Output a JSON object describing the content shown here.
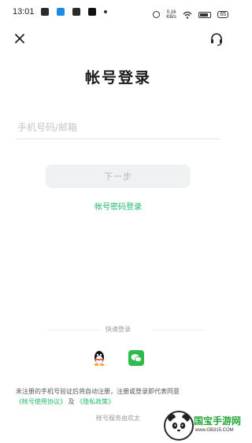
{
  "status_bar": {
    "time": "13:01",
    "net_speed_value": "0.16",
    "net_speed_unit": "KB/s",
    "battery": "65"
  },
  "header": {
    "close_icon": "close-icon",
    "support_icon": "headset-icon"
  },
  "title": "帐号登录",
  "account_field": {
    "placeholder": "手机号码/邮箱",
    "value": ""
  },
  "next_button": "下一步",
  "password_login_link": "帐号密码登录",
  "quick_login": {
    "label": "快速登录",
    "providers": [
      "qq-icon",
      "wechat-icon"
    ]
  },
  "agreement": {
    "prefix": "未注册的手机号验证后将自动注册，注册或登录即代表同意",
    "terms_link": "《帐号使用协议》",
    "and": "及",
    "privacy_link": "《隐私政策》"
  },
  "service_note": "帐号服务由欢太",
  "watermark": {
    "title": "国宝手游网",
    "url": "www.GB315.COM"
  },
  "colors": {
    "accent_green": "#22b86b",
    "button_bg": "#f0f1f3",
    "button_text": "#b5b8bd"
  }
}
